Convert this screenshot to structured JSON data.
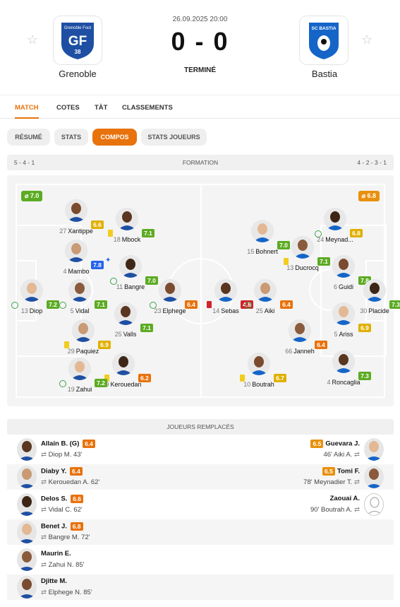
{
  "match": {
    "datetime": "26.09.2025 20:00",
    "score": "0 - 0",
    "status": "TERMINÉ",
    "home": {
      "name": "Grenoble",
      "crest_text": "Grenoble Foot",
      "crest_letters": "GF",
      "crest_number": "38"
    },
    "away": {
      "name": "Bastia",
      "crest_text": "SC BASTIA"
    }
  },
  "tabs": [
    {
      "label": "MATCH",
      "active": true
    },
    {
      "label": "COTES",
      "active": false
    },
    {
      "label": "TÀT",
      "active": false
    },
    {
      "label": "CLASSEMENTS",
      "active": false
    }
  ],
  "subtabs": [
    {
      "label": "RÉSUMÉ",
      "active": false
    },
    {
      "label": "STATS",
      "active": false
    },
    {
      "label": "COMPOS",
      "active": true
    },
    {
      "label": "STATS JOUEURS",
      "active": false
    }
  ],
  "formation": {
    "home": "5 - 4 - 1",
    "label": "FORMATION",
    "away": "4 - 2 - 3 - 1"
  },
  "team_ratings": {
    "home": "⌀ 7.0",
    "away": "⌀ 6.8"
  },
  "colors": {
    "accent": "#e8720c",
    "green_rating": "#5cab23",
    "orange_rating": "#e8900c",
    "red_rating": "#d1232a",
    "yellow_rating": "#e0b000",
    "yellow_card": "#f2cc1f",
    "red_card": "#d1232a"
  },
  "home_players": [
    {
      "number": "27",
      "name": "Xantippe",
      "rating": "6.6",
      "rating_color": "yellow",
      "card": null,
      "sub": false
    },
    {
      "number": "18",
      "name": "Mbock",
      "rating": "7.1",
      "rating_color": "green",
      "card": "yellow",
      "sub": false
    },
    {
      "number": "4",
      "name": "Mambo",
      "rating": "7.8",
      "rating_color": "blue",
      "card": null,
      "sub": false,
      "star": true
    },
    {
      "number": "11",
      "name": "Bangre",
      "rating": "7.0",
      "rating_color": "green",
      "card": null,
      "sub": true
    },
    {
      "number": "13",
      "name": "Diop",
      "rating": "7.2",
      "rating_color": "green",
      "card": null,
      "sub": true
    },
    {
      "number": "5",
      "name": "Vidal",
      "rating": "7.1",
      "rating_color": "green",
      "card": null,
      "sub": true
    },
    {
      "number": "23",
      "name": "Elphege",
      "rating": "6.4",
      "rating_color": "orange",
      "card": null,
      "sub": true
    },
    {
      "number": "25",
      "name": "Valls",
      "rating": "7.1",
      "rating_color": "green",
      "card": null,
      "sub": false
    },
    {
      "number": "29",
      "name": "Paquiez",
      "rating": "6.9",
      "rating_color": "yellow",
      "card": "yellow",
      "sub": false
    },
    {
      "number": "9",
      "name": "Kerouedan",
      "rating": "6.2",
      "rating_color": "orange",
      "card": "yellow",
      "sub": true
    },
    {
      "number": "19",
      "name": "Zahui",
      "rating": "7.2",
      "rating_color": "green",
      "card": null,
      "sub": true
    }
  ],
  "away_players": [
    {
      "number": "24",
      "name": "Meynad...",
      "rating": "6.8",
      "rating_color": "yellow",
      "card": null,
      "sub": true
    },
    {
      "number": "15",
      "name": "Bohnert",
      "rating": "7.0",
      "rating_color": "green",
      "card": null,
      "sub": false
    },
    {
      "number": "13",
      "name": "Ducrocq",
      "rating": "7.1",
      "rating_color": "green",
      "card": "yellow",
      "sub": false
    },
    {
      "number": "6",
      "name": "Guidi",
      "rating": "7.8",
      "rating_color": "green",
      "card": null,
      "sub": false
    },
    {
      "number": "14",
      "name": "Sebas",
      "rating": "4.8",
      "rating_color": "red",
      "card": "red",
      "sub": false
    },
    {
      "number": "25",
      "name": "Aiki",
      "rating": "6.4",
      "rating_color": "orange",
      "card": null,
      "sub": true
    },
    {
      "number": "30",
      "name": "Placide",
      "rating": "7.3",
      "rating_color": "green",
      "card": null,
      "sub": false
    },
    {
      "number": "5",
      "name": "Ariss",
      "rating": "6.9",
      "rating_color": "yellow",
      "card": null,
      "sub": false
    },
    {
      "number": "66",
      "name": "Janneh",
      "rating": "6.4",
      "rating_color": "orange",
      "card": null,
      "sub": false
    },
    {
      "number": "10",
      "name": "Boutrah",
      "rating": "6.7",
      "rating_color": "yellow",
      "card": "yellow",
      "sub": true
    },
    {
      "number": "4",
      "name": "Roncaglia",
      "rating": "7.3",
      "rating_color": "green",
      "card": null,
      "sub": false
    }
  ],
  "substitutes": {
    "title": "JOUEURS REMPLACÉS",
    "home": [
      {
        "name": "Allain B. (G)",
        "rating": "6.4",
        "detail": "Diop M. 43'"
      },
      {
        "name": "Diaby Y.",
        "rating": "6.4",
        "detail": "Kerouedan A. 62'"
      },
      {
        "name": "Delos S.",
        "rating": "6.6",
        "detail": "Vidal C. 62'"
      },
      {
        "name": "Benet J.",
        "rating": "6.8",
        "detail": "Bangre M. 72'"
      },
      {
        "name": "Maurin E.",
        "rating": "",
        "detail": "Zahui N. 85'"
      },
      {
        "name": "Djitte M.",
        "rating": "",
        "detail": "Elphege N. 85'"
      }
    ],
    "away": [
      {
        "name": "Guevara J.",
        "rating": "6.5",
        "detail": "46' Aiki A."
      },
      {
        "name": "Tomi F.",
        "rating": "6.5",
        "detail": "78' Meynadier T."
      },
      {
        "name": "Zaouai A.",
        "rating": "",
        "detail": "90' Boutrah A."
      }
    ]
  }
}
